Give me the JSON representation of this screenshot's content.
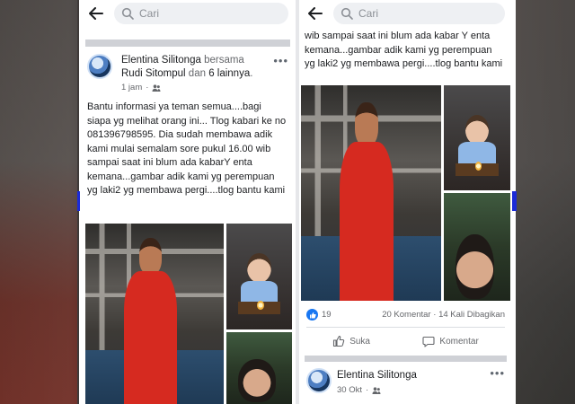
{
  "search": {
    "placeholder": "Cari"
  },
  "post": {
    "author": "Elentina Silitonga",
    "with_word": "bersama",
    "tagged": "Rudi Sitompul",
    "and_word": "dan",
    "others": "6 lainnya",
    "time": "1 jam",
    "audience_icon": "friends-icon",
    "text": "Bantu informasi ya teman semua....bagi siapa yg melihat orang ini... Tlog kabari ke no 081396798595. Dia sudah membawa adik kami mulai semalam sore pukul 16.00 wib sampai saat ini blum ada kabarY enta kemana...gambar adik kami yg perempuan yg laki2 yg membawa pergi....tlog bantu kami",
    "text_tail": "wib sampai saat ini blum ada kabar Y enta kemana...gambar adik kami yg perempuan yg laki2 yg membawa pergi....tlog bantu kami",
    "reactions": "19",
    "comments": "20 Komentar",
    "shares": "14 Kali Dibagikan",
    "separator": "·"
  },
  "actions": {
    "like": "Suka",
    "comment": "Komentar"
  },
  "post2": {
    "author": "Elentina Silitonga",
    "time": "30 Okt"
  },
  "colors": {
    "accent": "#1877f2",
    "frame_marker": "#1b2bd8"
  }
}
